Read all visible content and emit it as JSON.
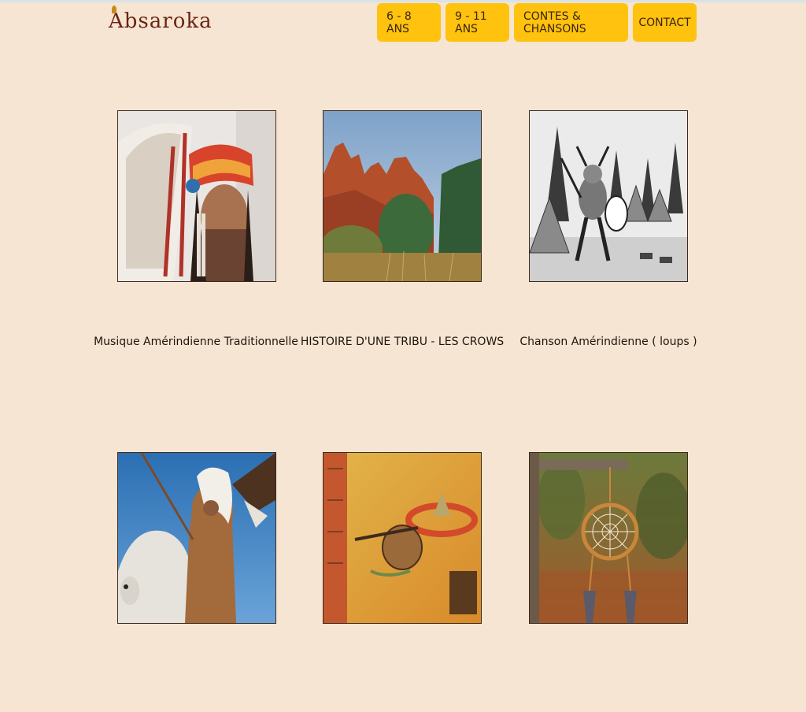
{
  "brand": {
    "logo_text": "Absaroka"
  },
  "nav": {
    "items": [
      {
        "label": "6 - 8 ANS"
      },
      {
        "label": "9 - 11 ANS"
      },
      {
        "label": "CONTES & CHANSONS"
      },
      {
        "label": "CONTACT"
      }
    ]
  },
  "cards": [
    {
      "title": "Musique Amérindienne Traditionnelle",
      "image": "chief-headdress-portrait"
    },
    {
      "title": "HISTOIRE D'UNE TRIBU - LES CROWS",
      "image": "red-rock-landscape"
    },
    {
      "title": "Chanson Amérindienne ( loups )",
      "image": "engraving-ritual-dance"
    },
    {
      "title": "",
      "image": "warrior-on-horse-with-eagle"
    },
    {
      "title": "",
      "image": "tribal-painting-campfire"
    },
    {
      "title": "",
      "image": "dreamcatcher-in-forest"
    }
  ],
  "colors": {
    "background": "#f5e5d2",
    "nav_button": "#ffc20e",
    "logo": "#6b2414"
  }
}
